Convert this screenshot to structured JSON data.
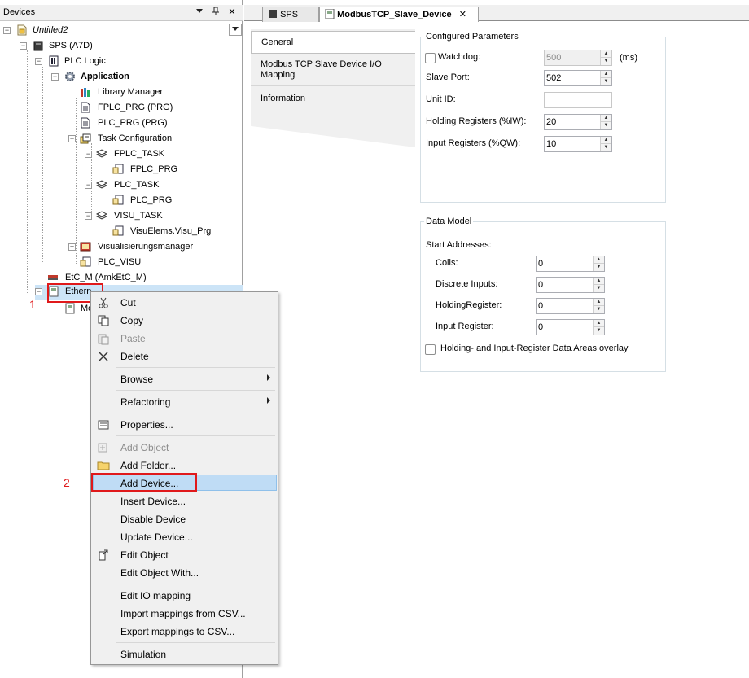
{
  "devices_pane": {
    "title": "Devices",
    "pin_glyph": "↓",
    "dock_glyph": "†",
    "close_glyph": "✕",
    "dropdown_icon": "chevron-down-icon"
  },
  "tree": {
    "project": "Untitled2",
    "plc": "SPS (A7D)",
    "plc_logic": "PLC Logic",
    "application": "Application",
    "library_manager": "Library Manager",
    "fplc_prg": "FPLC_PRG (PRG)",
    "plc_prg": "PLC_PRG (PRG)",
    "task_configuration": "Task Configuration",
    "fplc_task": "FPLC_TASK",
    "fplc_task_call": "FPLC_PRG",
    "plc_task": "PLC_TASK",
    "plc_task_call": "PLC_PRG",
    "visu_task": "VISU_TASK",
    "visu_task_call": "VisuElems.Visu_Prg",
    "visu_manager": "Visualisierungsmanager",
    "plc_visu": "PLC_VISU",
    "etc_m": "EtC_M (AmkEtC_M)",
    "ethernet": "Ethern",
    "ethernet_hidden": "(Ethernet)",
    "modbus_child": "Mo"
  },
  "tabs": [
    {
      "label": "SPS"
    },
    {
      "label": "ModbusTCP_Slave_Device",
      "close": "✕"
    }
  ],
  "side_tabs": [
    {
      "label": "General"
    },
    {
      "label": "Modbus TCP Slave Device I/O Mapping"
    },
    {
      "label": "Information"
    }
  ],
  "configured": {
    "legend": "Configured Parameters",
    "watchdog_label": "Watchdog:",
    "watchdog_value": "500",
    "watchdog_unit": "(ms)",
    "slave_port_label": "Slave Port:",
    "slave_port_value": "502",
    "unit_id_label": "Unit ID:",
    "unit_id_value": "",
    "holding_label": "Holding Registers (%IW):",
    "holding_value": "20",
    "input_label": "Input Registers (%QW):",
    "input_value": "10"
  },
  "data_model": {
    "legend": "Data Model",
    "start_addresses": "Start Addresses:",
    "coils_label": "Coils:",
    "coils_value": "0",
    "discrete_label": "Discrete Inputs:",
    "discrete_value": "0",
    "holding_reg_label": "HoldingRegister:",
    "holding_reg_value": "0",
    "input_reg_label": "Input Register:",
    "input_reg_value": "0",
    "overlay_label": "Holding- and Input-Register Data Areas overlay"
  },
  "context_menu": {
    "cut": "Cut",
    "copy": "Copy",
    "paste": "Paste",
    "delete": "Delete",
    "browse": "Browse",
    "refactoring": "Refactoring",
    "properties": "Properties...",
    "add_object": "Add Object",
    "add_folder": "Add Folder...",
    "add_device": "Add Device...",
    "insert_device": "Insert Device...",
    "disable_device": "Disable Device",
    "update_device": "Update Device...",
    "edit_object": "Edit Object",
    "edit_object_with": "Edit Object With...",
    "edit_io_mapping": "Edit IO mapping",
    "import_csv": "Import mappings from CSV...",
    "export_csv": "Export mappings to CSV...",
    "simulation": "Simulation"
  },
  "callouts": {
    "one": "1",
    "two": "2"
  },
  "colors": {
    "highlight": "#bfdcf5",
    "callout_red": "#e0191b",
    "selected_row": "#cce4f7"
  }
}
